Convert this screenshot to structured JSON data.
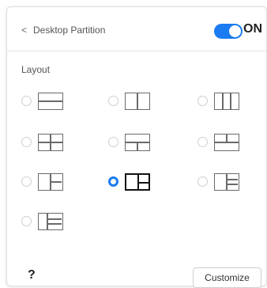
{
  "header": {
    "back_icon": "chevron-left-icon",
    "back_glyph": "<",
    "title": "Desktop Partition",
    "toggle_label": "ON",
    "toggle_on": true,
    "accent": "#1a7cf0"
  },
  "layout_section": {
    "label": "Layout",
    "selected_index": 7,
    "options": [
      "horizontal-2-split",
      "vertical-2-split",
      "vertical-3-split",
      "grid-2x2",
      "top-1-bottom-2",
      "top-2-bottom-1",
      "left-1-right-2",
      "left-2-right-1",
      "left-1-right-3",
      "left-3-right-1"
    ]
  },
  "footer": {
    "help_glyph": "?",
    "customize_label": "Customize"
  }
}
